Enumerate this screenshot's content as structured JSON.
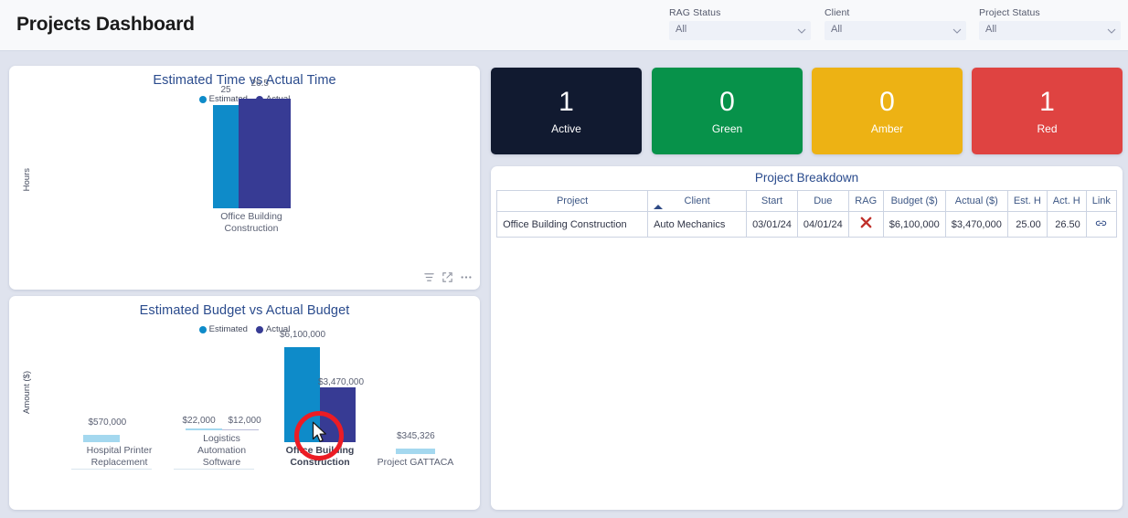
{
  "header": {
    "title": "Projects Dashboard",
    "filters": [
      {
        "label": "RAG Status",
        "value": "All"
      },
      {
        "label": "Client",
        "value": "All"
      },
      {
        "label": "Project Status",
        "value": "All"
      }
    ]
  },
  "kpis": [
    {
      "value": "1",
      "label": "Active",
      "color": "#111a30"
    },
    {
      "value": "0",
      "label": "Green",
      "color": "#07924a"
    },
    {
      "value": "0",
      "label": "Amber",
      "color": "#edb214"
    },
    {
      "value": "1",
      "label": "Red",
      "color": "#df4341"
    }
  ],
  "chart_data": [
    {
      "type": "bar",
      "title": "Estimated Time vs Actual Time",
      "xlabel": "",
      "ylabel": "Hours",
      "categories": [
        "Office Building Construction"
      ],
      "series": [
        {
          "name": "Estimated",
          "values": [
            25
          ],
          "color": "#0e8bc9",
          "labels": [
            "25"
          ]
        },
        {
          "name": "Actual",
          "values": [
            26.5
          ],
          "color": "#373b94",
          "labels": [
            "26.5"
          ]
        }
      ],
      "legend": [
        "Estimated",
        "Actual"
      ],
      "legend_position": "top",
      "ylim": [
        0,
        26.5
      ],
      "grid": false
    },
    {
      "type": "bar",
      "title": "Estimated Budget vs Actual Budget",
      "xlabel": "",
      "ylabel": "Amount ($)",
      "categories": [
        "Hospital Printer\nReplacement",
        "Logistics\nAutomation\nSoftware",
        "Office Building\nConstruction",
        "Project GATTACA"
      ],
      "highlighted_category": "Office Building\nConstruction",
      "series": [
        {
          "name": "Estimated",
          "values": [
            570000,
            22000,
            6100000,
            345326
          ],
          "color": "#0e8bc9",
          "labels": [
            "$570,000",
            "$22,000",
            "$6,100,000",
            "$345,326"
          ]
        },
        {
          "name": "Actual",
          "values": [
            0,
            12000,
            3470000,
            0
          ],
          "color": "#373b94",
          "labels": [
            "",
            "$12,000",
            "$3,470,000",
            ""
          ]
        }
      ],
      "legend": [
        "Estimated",
        "Actual"
      ],
      "legend_position": "top",
      "ylim": [
        0,
        6100000
      ],
      "grid": false
    }
  ],
  "table": {
    "title": "Project Breakdown",
    "sorted_column": "Client",
    "sort_direction": "ascending",
    "columns": [
      "Project",
      "Client",
      "Start",
      "Due",
      "RAG",
      "Budget ($)",
      "Actual ($)",
      "Est. H",
      "Act. H",
      "Link"
    ],
    "rows": [
      {
        "project": "Office Building Construction",
        "client": "Auto Mechanics",
        "start": "03/01/24",
        "due": "04/01/24",
        "rag": "✕",
        "budget": "$6,100,000",
        "actual": "$3,470,000",
        "est_h": "25.00",
        "act_h": "26.50",
        "link": "link-icon"
      }
    ]
  },
  "viz_tools": {
    "filter_icon": "filter-icon",
    "focus_icon": "focus-mode-icon",
    "more_icon": "more-options-icon"
  },
  "colors": {
    "estimated": "#0e8bc9",
    "actual": "#373b94",
    "estimated_light": "#a4d8ef",
    "title": "#2a4b8d",
    "rag_red": "#c0312b",
    "cursor_ring": "#ec1c24",
    "page_bg": "#dfe3ee"
  }
}
